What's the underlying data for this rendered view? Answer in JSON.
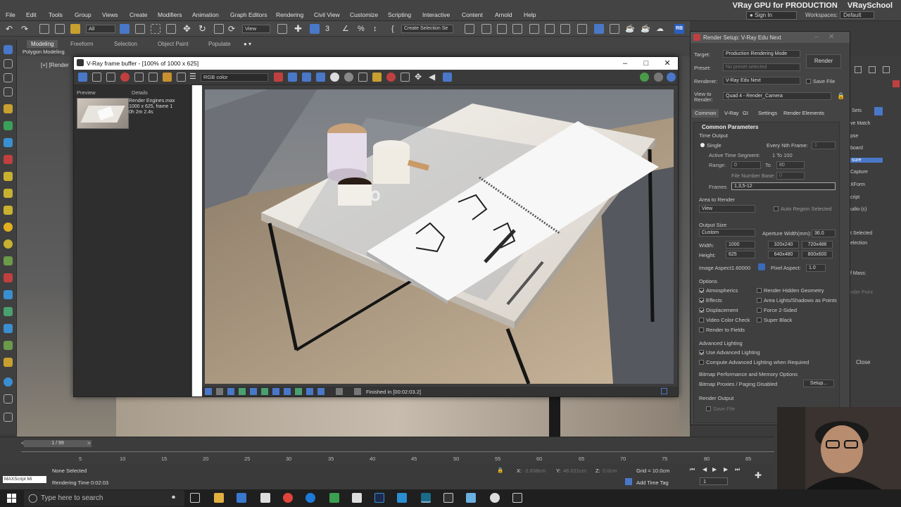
{
  "menu": {
    "items": [
      "File",
      "Edit",
      "Tools",
      "Group",
      "Views",
      "Create",
      "Modifiers",
      "Animation",
      "Graph Editors",
      "Rendering",
      "Civil View",
      "Customize",
      "Scripting",
      "Interactive",
      "Content",
      "Arnold",
      "Help"
    ],
    "sign_in": "Sign In",
    "workspaces_label": "Workspaces:",
    "workspaces_value": "Default"
  },
  "header": {
    "title_left": "VRay GPU for PRODUCTION",
    "title_right": "VRaySchool"
  },
  "toolbar": {
    "selection_filter": "All",
    "view_dropdown": "View",
    "selection_set_placeholder": "Create Selection Se"
  },
  "ribbon": {
    "tabs": [
      "Modeling",
      "Freeform",
      "Selection",
      "Object Paint",
      "Populate"
    ],
    "subtab": "Polygon Modeling"
  },
  "viewport": {
    "label": "[+] [Render"
  },
  "vfb": {
    "title": "V-Ray frame buffer - [100% of 1000 x 625]",
    "channel": "RGB color",
    "side_tabs": [
      "Preview",
      "Details"
    ],
    "history_details": [
      "Render Engines.max",
      "1000 x 625, frame 1",
      "0h 2m 2.4s"
    ],
    "status": "Finished in [00:02:03.2]"
  },
  "render_setup": {
    "title": "Render Setup: V-Ray Edu Next",
    "target_label": "Target:",
    "target_value": "Production Rendering Mode",
    "preset_label": "Preset:",
    "preset_value": "No preset selected",
    "renderer_label": "Renderer:",
    "renderer_value": "V-Ray Edu Next",
    "save_file": "Save File",
    "view_label_1": "View to",
    "view_label_2": "Render:",
    "view_value": "Quad 4 - Render_Camera",
    "render_button": "Render",
    "tabs": [
      "Common",
      "V-Ray",
      "GI",
      "Settings",
      "Render Elements"
    ],
    "section_common": "Common Parameters",
    "time_output": "Time Output",
    "single": "Single",
    "every_nth": "Every Nth Frame:",
    "every_nth_value": "1",
    "active_segment": "Active Time Segment:",
    "active_segment_value": "1 To 100",
    "range_label": "Range:",
    "range_from": "0",
    "range_to_label": "To",
    "range_to": "80",
    "file_number_base": "File Number Base:",
    "file_number_base_value": "0",
    "frames_label": "Frames",
    "frames_value": "1,3,5-12",
    "area_to_render": "Area to Render",
    "area_value": "View",
    "auto_region": "Auto Region Selected",
    "output_size": "Output Size",
    "output_preset": "Custom",
    "aperture_label": "Aperture Width(mm):",
    "aperture_value": "36.0",
    "width_label": "Width:",
    "width_value": "1000",
    "height_label": "Height:",
    "height_value": "625",
    "preset_sizes": [
      "320x240",
      "720x486",
      "640x480",
      "800x600"
    ],
    "image_aspect_label": "Image Aspect:",
    "image_aspect_value": "1.60000",
    "pixel_aspect_label": "Pixel Aspect:",
    "pixel_aspect_value": "1.0",
    "options": "Options",
    "options_left": [
      "Atmospherics",
      "Effects",
      "Displacement",
      "Video Color Check",
      "Render to Fields"
    ],
    "options_left_checked": [
      true,
      true,
      true,
      false,
      false
    ],
    "options_right": [
      "Render Hidden Geometry",
      "Area Lights/Shadows as Points",
      "Force 2-Sided",
      "Super Black"
    ],
    "advanced_lighting": "Advanced Lighting",
    "use_advanced_lighting": "Use Advanced Lighting",
    "compute_advanced_lighting": "Compute Advanced Lighting when Required",
    "bitmap_performance": "Bitmap Performance and Memory Options",
    "bitmap_proxies": "Bitmap Proxies / Paging Disabled",
    "setup_button": "Setup...",
    "render_output": "Render Output",
    "save_file_2": "Save File"
  },
  "dock": {
    "items": [
      "Sets",
      "ve Match",
      "pse",
      "board",
      "sure",
      "Capture",
      "XForm",
      "cript",
      "udio (c)",
      "t Selected",
      "election",
      "f Mass:",
      "nder Point"
    ],
    "selected_index": 4,
    "close": "Close"
  },
  "timeline": {
    "frame": "1 / 99",
    "ticks": [
      "5",
      "10",
      "15",
      "20",
      "25",
      "30",
      "35",
      "40",
      "45",
      "50",
      "55",
      "60",
      "65",
      "70",
      "75",
      "80",
      "85"
    ]
  },
  "statusbar": {
    "maxscript": "MAXScript Mi",
    "selection": "None Selected",
    "rendering_time": "Rendering Time  0:02:03",
    "x_label": "X:",
    "x_value": "-2.838cm",
    "y_label": "Y:",
    "y_value": "46.021cm",
    "z_label": "Z:",
    "z_value": "0.0cm",
    "grid": "Grid = 10.0cm",
    "add_time_tag": "Add Time Tag",
    "frame_field": "1"
  },
  "taskbar": {
    "search_placeholder": "Type here to search"
  },
  "colors": {
    "accent": "#4a78c8",
    "vray_red": "#c0392b",
    "ui_bg": "#444444"
  }
}
